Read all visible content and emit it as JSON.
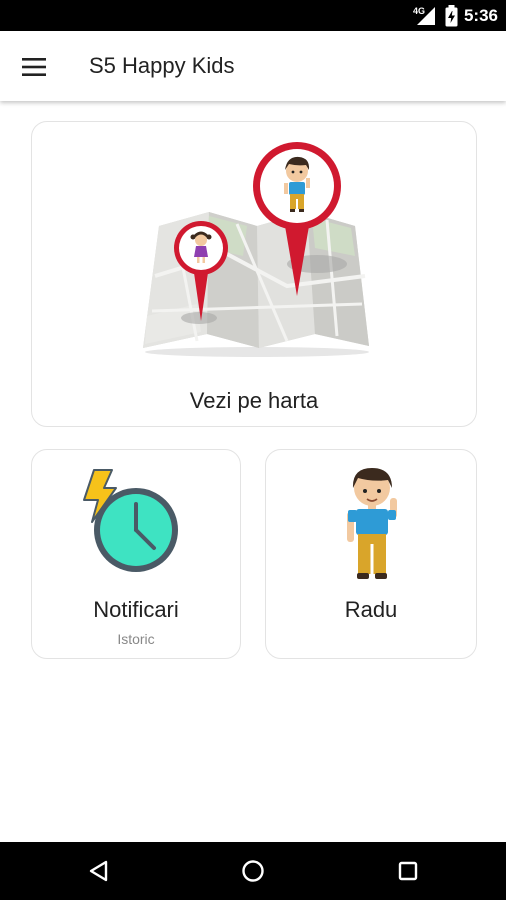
{
  "status_bar": {
    "network": "4G",
    "time": "5:36"
  },
  "app_bar": {
    "title": "S5 Happy Kids",
    "menu_icon": "hamburger-menu-icon"
  },
  "cards": {
    "map": {
      "label": "Vezi pe harta",
      "icon": "map-pins-illustration"
    },
    "notifications": {
      "label": "Notificari",
      "sublabel": "Istoric",
      "icon": "clock-lightning-illustration"
    },
    "child": {
      "label": "Radu",
      "icon": "boy-avatar-illustration"
    }
  },
  "nav_bar": {
    "back_icon": "back-triangle-icon",
    "home_icon": "home-circle-icon",
    "recents_icon": "recents-square-icon"
  },
  "colors": {
    "pin_red": "#d0192f",
    "clock_teal": "#3ee3c2",
    "bolt_yellow": "#f6c21a",
    "shirt_blue": "#2e9bd6",
    "pants_mustard": "#d9a52a"
  }
}
